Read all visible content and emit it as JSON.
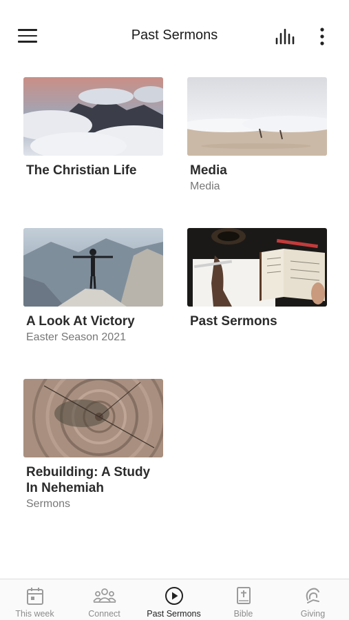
{
  "header": {
    "title": "Past Sermons",
    "menu_icon": "hamburger-menu-icon",
    "audio_icon": "audio-bars-icon",
    "more_icon": "more-vertical-icon"
  },
  "cards": [
    {
      "title": "The Christian Life",
      "subtitle": ""
    },
    {
      "title": "Media",
      "subtitle": "Media"
    },
    {
      "title": "A Look At Victory",
      "subtitle": "Easter Season 2021"
    },
    {
      "title": "Past Sermons",
      "subtitle": ""
    },
    {
      "title": "Rebuilding: A Study In Nehemiah",
      "subtitle": "Sermons"
    }
  ],
  "tabbar": {
    "tabs": [
      {
        "label": "This week",
        "icon": "calendar-icon",
        "active": false
      },
      {
        "label": "Connect",
        "icon": "people-group-icon",
        "active": false
      },
      {
        "label": "Past Sermons",
        "icon": "play-circle-icon",
        "active": true
      },
      {
        "label": "Bible",
        "icon": "bible-cross-icon",
        "active": false
      },
      {
        "label": "Giving",
        "icon": "giving-hand-icon",
        "active": false
      }
    ]
  }
}
